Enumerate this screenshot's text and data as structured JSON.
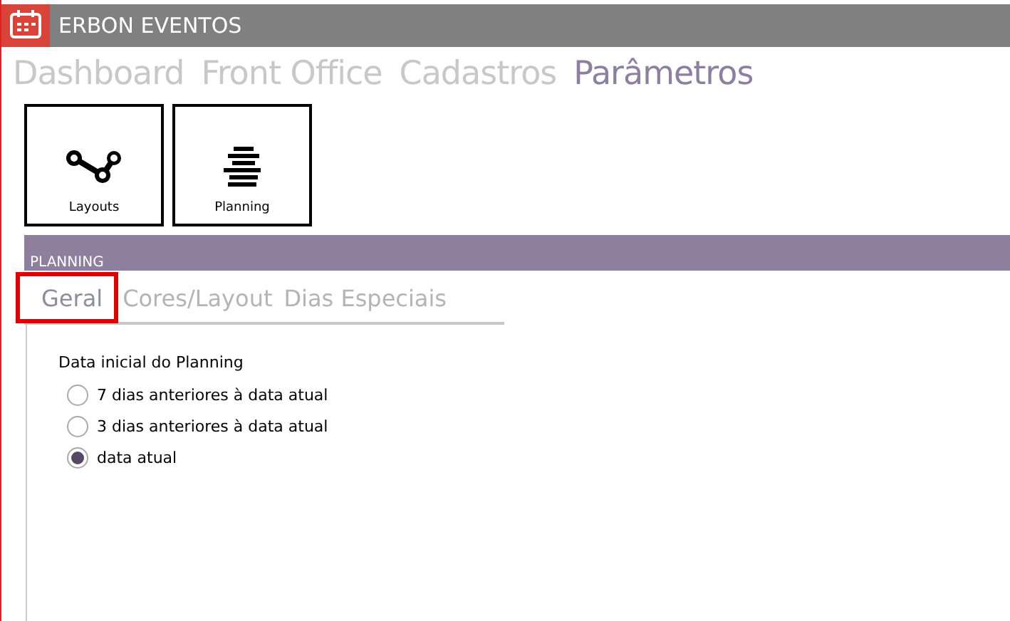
{
  "window": {
    "title": "ERBON EVENTOS"
  },
  "nav": [
    {
      "label": "Dashboard",
      "selected": false
    },
    {
      "label": "Front Office",
      "selected": false
    },
    {
      "label": "Cadastros",
      "selected": false
    },
    {
      "label": "Parâmetros",
      "selected": true
    }
  ],
  "tiles": [
    {
      "label": "Layouts",
      "kind": "layouts"
    },
    {
      "label": "Planning",
      "kind": "planning"
    }
  ],
  "section": {
    "title": "PLANNING"
  },
  "tabs": [
    {
      "label": "Geral",
      "selected": true
    },
    {
      "label": "Cores/Layout",
      "selected": false
    },
    {
      "label": "Dias Especiais",
      "selected": false
    }
  ],
  "group": {
    "label": "Data inicial do Planning"
  },
  "options": [
    {
      "label": "7 dias anteriores à data atual",
      "selected": false
    },
    {
      "label": "3 dias anteriores à data atual",
      "selected": false
    },
    {
      "label": "data atual",
      "selected": true
    }
  ]
}
